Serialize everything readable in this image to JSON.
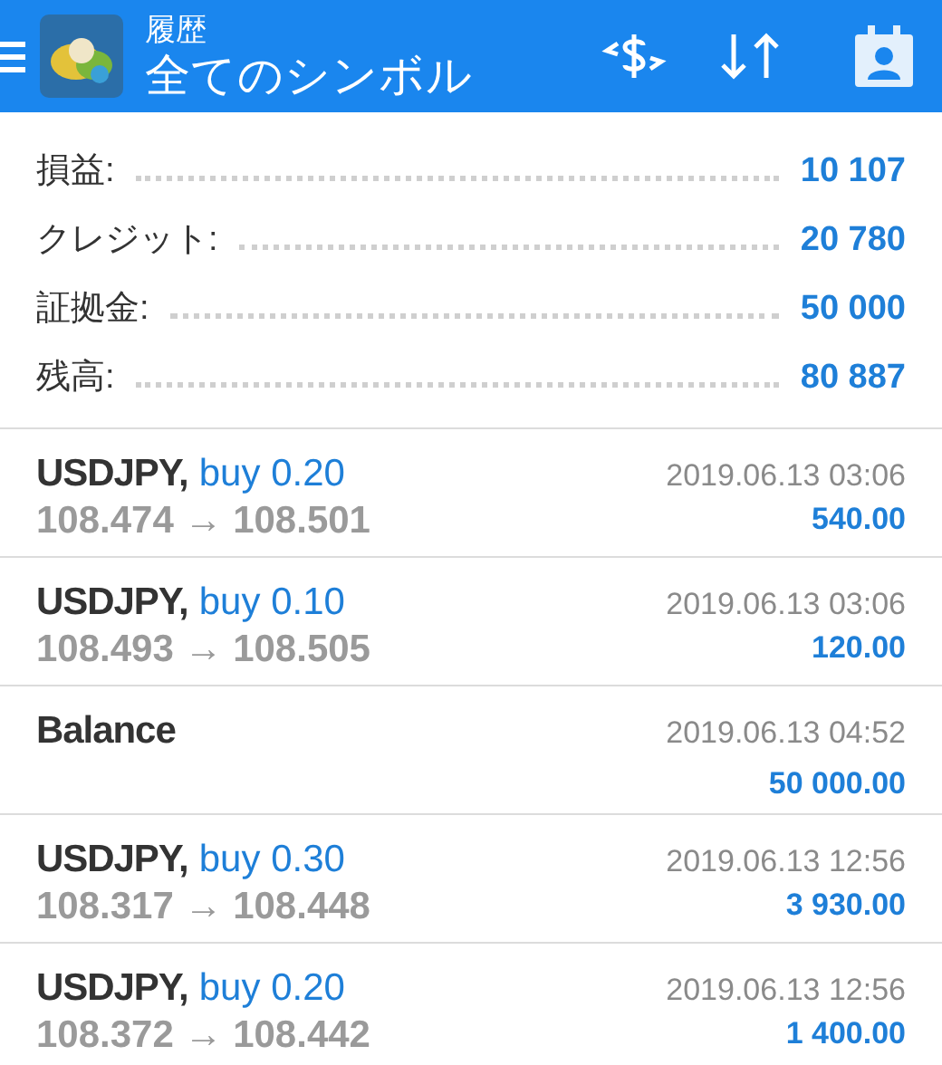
{
  "header": {
    "subtitle": "履歴",
    "title": "全てのシンボル"
  },
  "summary": [
    {
      "label": "損益:",
      "value": "10 107"
    },
    {
      "label": "クレジット:",
      "value": "20 780"
    },
    {
      "label": "証拠金:",
      "value": "50 000"
    },
    {
      "label": "残高:",
      "value": "80 887"
    }
  ],
  "deals": [
    {
      "kind": "trade",
      "symbol": "USDJPY,",
      "action": "buy 0.20",
      "prices": "108.474 → 108.501",
      "time": "2019.06.13 03:06",
      "profit": "540.00"
    },
    {
      "kind": "trade",
      "symbol": "USDJPY,",
      "action": "buy 0.10",
      "prices": "108.493 → 108.505",
      "time": "2019.06.13 03:06",
      "profit": "120.00"
    },
    {
      "kind": "balance",
      "symbol": "Balance",
      "time": "2019.06.13 04:52",
      "profit": "50 000.00"
    },
    {
      "kind": "trade",
      "symbol": "USDJPY,",
      "action": "buy 0.30",
      "prices": "108.317 → 108.448",
      "time": "2019.06.13 12:56",
      "profit": "3 930.00"
    },
    {
      "kind": "trade",
      "symbol": "USDJPY,",
      "action": "buy 0.20",
      "prices": "108.372 → 108.442",
      "time": "2019.06.13 12:56",
      "profit": "1 400.00"
    }
  ]
}
